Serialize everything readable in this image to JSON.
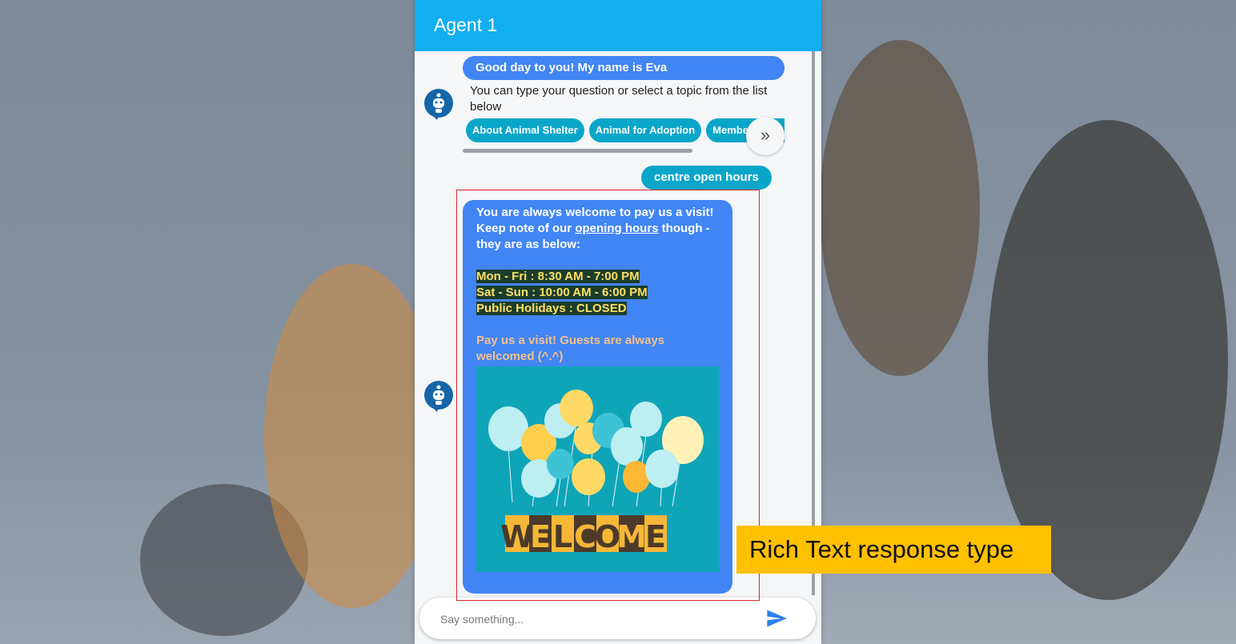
{
  "header": {
    "title": "Agent 1"
  },
  "bot_intro": {
    "greeting": "Good day to you! My name is Eva",
    "prompt": "You can type your question or select a topic from the list below"
  },
  "topics": [
    "About Animal Shelter",
    "Animal for Adoption",
    "Membership Sign Up"
  ],
  "user_message": "centre open hours",
  "rich_reply": {
    "line1": "You are always welcome to pay us a visit!",
    "line2_pre": "Keep note of our ",
    "line2_link": "opening hours",
    "line2_post": " though - they are as below:",
    "hours": [
      "Mon - Fri : 8:30 AM - 7:00 PM",
      "Sat - Sun : 10:00 AM - 6:00 PM",
      "Public Holidays : CLOSED"
    ],
    "visit": "Pay us a visit! Guests are always welcomed (^.^)",
    "image_banner": "WELCOME"
  },
  "input": {
    "placeholder": "Say something..."
  },
  "callout": "Rich Text response type",
  "colors": {
    "header": "#12aef2",
    "bot_bubble": "#4285f4",
    "chip": "#0aa6c9",
    "callout": "#ffc000",
    "highlight_box": "#d9252a"
  }
}
